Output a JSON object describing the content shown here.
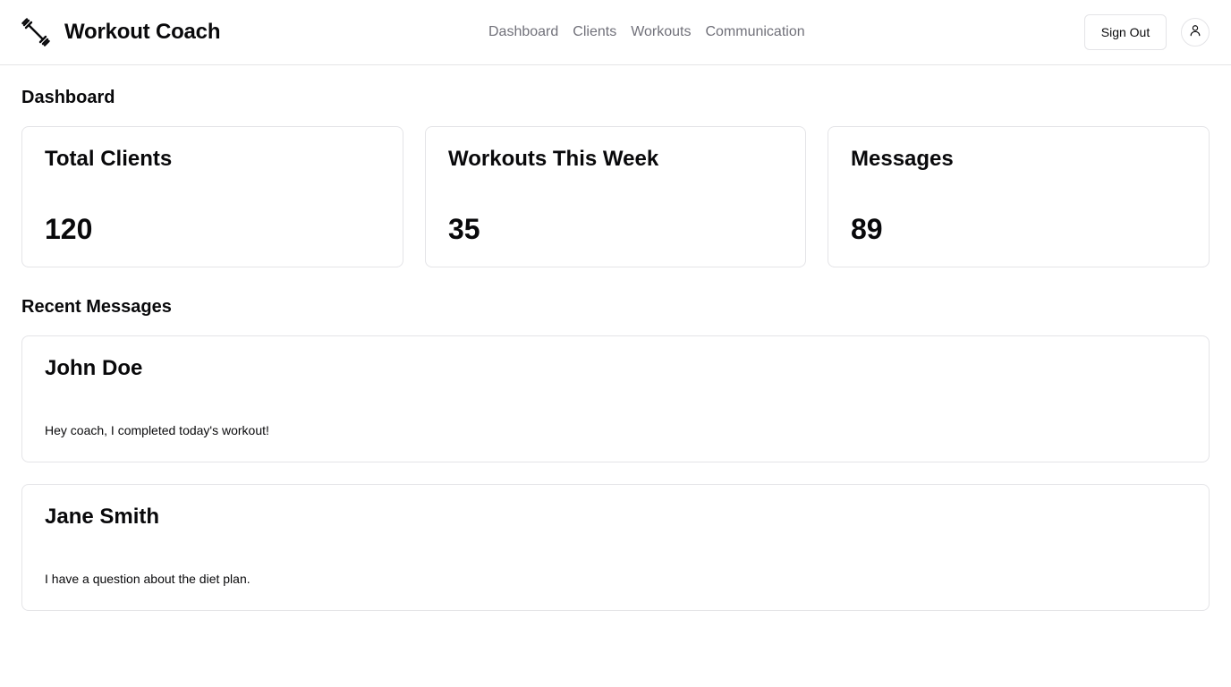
{
  "app": {
    "title": "Workout Coach",
    "logo_icon": "dumbbell-icon"
  },
  "nav": {
    "items": [
      {
        "label": "Dashboard"
      },
      {
        "label": "Clients"
      },
      {
        "label": "Workouts"
      },
      {
        "label": "Communication"
      }
    ]
  },
  "header": {
    "signout_label": "Sign Out",
    "avatar_icon": "user-icon"
  },
  "dashboard": {
    "title": "Dashboard",
    "stats": [
      {
        "label": "Total Clients",
        "value": "120"
      },
      {
        "label": "Workouts This Week",
        "value": "35"
      },
      {
        "label": "Messages",
        "value": "89"
      }
    ]
  },
  "recent_messages": {
    "title": "Recent Messages",
    "items": [
      {
        "name": "John Doe",
        "text": "Hey coach, I completed today's workout!"
      },
      {
        "name": "Jane Smith",
        "text": "I have a question about the diet plan."
      }
    ]
  },
  "colors": {
    "text": "#09090b",
    "muted": "#71717a",
    "border": "#e4e4e7",
    "background": "#ffffff"
  }
}
